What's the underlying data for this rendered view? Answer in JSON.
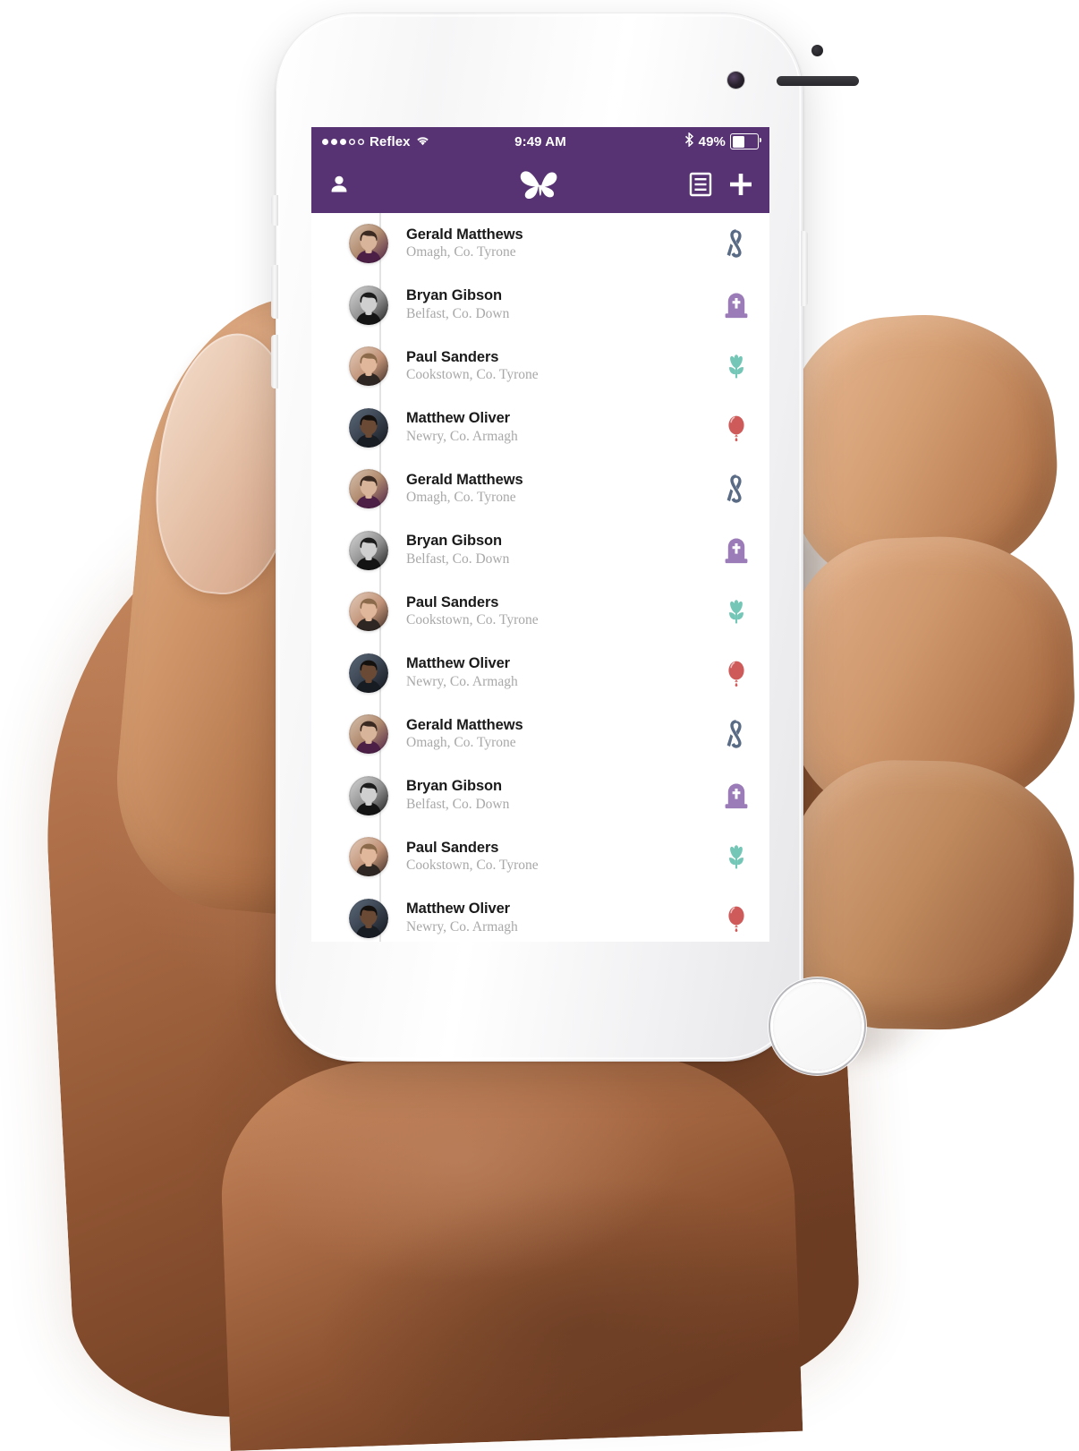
{
  "device": {
    "name": "white-iphone",
    "home_button": "home-button"
  },
  "status_bar": {
    "signal_dots_filled": 3,
    "signal_dots_total": 5,
    "carrier": "Reflex",
    "wifi_icon": "wifi-icon",
    "time": "9:49 AM",
    "bluetooth_icon": "bluetooth-icon",
    "battery_percent": "49%",
    "battery_level": 49,
    "background_color": "#573373",
    "text_color": "#ffffff"
  },
  "nav_bar": {
    "background_color": "#573373",
    "profile_icon": "person-icon",
    "logo_icon": "butterfly-logo",
    "list_icon": "document-list-icon",
    "add_icon": "plus-icon"
  },
  "theme": {
    "purple": "#573373",
    "ribbon_color": "#5a6b85",
    "gravestone_color": "#9b7cb8",
    "tulip_color": "#74c6b6",
    "balloon_color": "#cf5a5a",
    "name_color": "#1a1a1a",
    "location_color": "#a8a8a8",
    "timeline_color": "#e3e3e3"
  },
  "list": {
    "items": [
      {
        "name": "Gerald Matthews",
        "location": "Omagh, Co. Tyrone",
        "icon": "ribbon-icon",
        "avatar": "avatar-gerald",
        "partial": false
      },
      {
        "name": "Bryan Gibson",
        "location": "Belfast, Co. Down",
        "icon": "gravestone-icon",
        "avatar": "avatar-bryan",
        "partial": false
      },
      {
        "name": "Paul Sanders",
        "location": "Cookstown, Co. Tyrone",
        "icon": "tulip-icon",
        "avatar": "avatar-paul",
        "partial": false
      },
      {
        "name": "Matthew Oliver",
        "location": "Newry, Co. Armagh",
        "icon": "balloon-icon",
        "avatar": "avatar-matthew",
        "partial": false
      },
      {
        "name": "Gerald Matthews",
        "location": "Omagh, Co. Tyrone",
        "icon": "ribbon-icon",
        "avatar": "avatar-gerald",
        "partial": false
      },
      {
        "name": "Bryan Gibson",
        "location": "Belfast, Co. Down",
        "icon": "gravestone-icon",
        "avatar": "avatar-bryan",
        "partial": false
      },
      {
        "name": "Paul Sanders",
        "location": "Cookstown, Co. Tyrone",
        "icon": "tulip-icon",
        "avatar": "avatar-paul",
        "partial": false
      },
      {
        "name": "Matthew Oliver",
        "location": "Newry, Co. Armagh",
        "icon": "balloon-icon",
        "avatar": "avatar-matthew",
        "partial": false
      },
      {
        "name": "Gerald Matthews",
        "location": "Omagh, Co. Tyrone",
        "icon": "ribbon-icon",
        "avatar": "avatar-gerald",
        "partial": false
      },
      {
        "name": "Bryan Gibson",
        "location": "Belfast, Co. Down",
        "icon": "gravestone-icon",
        "avatar": "avatar-bryan",
        "partial": false
      },
      {
        "name": "Paul Sanders",
        "location": "Cookstown, Co. Tyrone",
        "icon": "tulip-icon",
        "avatar": "avatar-paul",
        "partial": false
      },
      {
        "name": "Matthew Oliver",
        "location": "Newry, Co. Armagh",
        "icon": "balloon-icon",
        "avatar": "avatar-matthew",
        "partial": true
      }
    ]
  }
}
